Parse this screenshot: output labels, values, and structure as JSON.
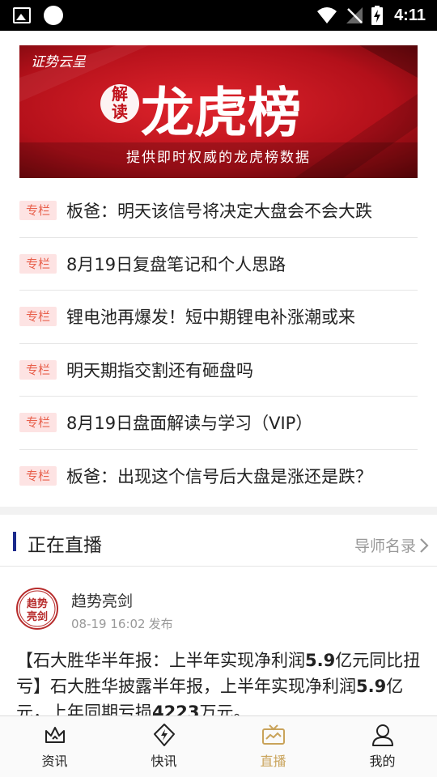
{
  "status_bar": {
    "time": "4:11"
  },
  "banner": {
    "brand": "证势云呈",
    "seal_chars": [
      "解",
      "读"
    ],
    "headline": "龙虎榜",
    "subtitle": "提供即时权威的龙虎榜数据"
  },
  "articles": [
    {
      "tag": "专栏",
      "title": "板爸：明天该信号将决定大盘会不会大跌"
    },
    {
      "tag": "专栏",
      "title": "8月19日复盘笔记和个人思路"
    },
    {
      "tag": "专栏",
      "title": "锂电池再爆发！短中期锂电补涨潮或来"
    },
    {
      "tag": "专栏",
      "title": "明天期指交割还有砸盘吗"
    },
    {
      "tag": "专栏",
      "title": "8月19日盘面解读与学习（VIP）"
    },
    {
      "tag": "专栏",
      "title": "板爸：出现这个信号后大盘是涨还是跌？"
    }
  ],
  "live": {
    "title": "正在直播",
    "mentor_link": "导师名录"
  },
  "post": {
    "avatar_text": [
      "趋势",
      "亮剑"
    ],
    "author": "趋势亮剑",
    "datetime": "08-19 16:02",
    "publish_label": "发布",
    "body": {
      "p1": "【石大胜华半年报：上半年实现净利润",
      "b1": "5.9",
      "p2": "亿元同比扭亏】石大胜华披露半年报，上半年实现净利润",
      "b2": "5.9",
      "p3": "亿元，上年同期亏损",
      "b3": "4223",
      "p4": "万元。"
    }
  },
  "nav": {
    "items": [
      {
        "label": "资讯",
        "icon": "crown-icon"
      },
      {
        "label": "快讯",
        "icon": "lightning-icon"
      },
      {
        "label": "直播",
        "icon": "tv-icon",
        "active": true
      },
      {
        "label": "我的",
        "icon": "user-icon"
      }
    ],
    "active_color": "#c9a35a"
  },
  "colors": {
    "tag_bg": "#fde3e3",
    "tag_text": "#e8604c",
    "live_bar": "#1a2a8c",
    "banner_red": "#c0121b"
  }
}
